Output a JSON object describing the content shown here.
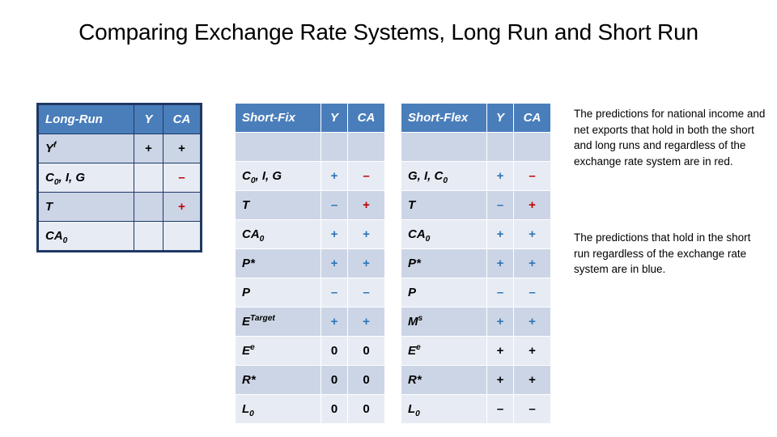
{
  "slide": {
    "title": "Comparing Exchange Rate Systems, Long Run and Short Run"
  },
  "colors": {
    "header_blue": "#4a7ebb",
    "band_dark": "#ccd5e6",
    "band_light": "#e7ecf4",
    "marker_blue": "#2e75b6",
    "marker_red": "#c00000",
    "marker_black": "#000000",
    "frame_navy": "#1f3864"
  },
  "tables": {
    "long_run": {
      "headers": [
        "Long-Run",
        "Y",
        "CA"
      ],
      "rows": [
        {
          "label": "Y",
          "label_sup": "f",
          "label_sub": "",
          "y": "+",
          "y_color": "black",
          "ca": "+",
          "ca_color": "black"
        },
        {
          "label": "C",
          "label_sub": "0",
          "label_tail": ", I, G",
          "y": "",
          "y_color": "black",
          "ca": "–",
          "ca_color": "red"
        },
        {
          "label": "T",
          "label_sub": "",
          "y": "",
          "y_color": "black",
          "ca": "+",
          "ca_color": "red"
        },
        {
          "label": "CA",
          "label_sub": "0",
          "y": "",
          "y_color": "black",
          "ca": "",
          "ca_color": "black"
        }
      ]
    },
    "short_fix": {
      "headers": [
        "Short-Fix",
        "Y",
        "CA"
      ],
      "rows": [
        {
          "label": "",
          "label_sub": "",
          "y": "",
          "y_color": "black",
          "ca": "",
          "ca_color": "black"
        },
        {
          "label": "C",
          "label_sub": "0",
          "label_tail": ", I, G",
          "y": "+",
          "y_color": "blue",
          "ca": "–",
          "ca_color": "red"
        },
        {
          "label": "T",
          "label_sub": "",
          "y": "–",
          "y_color": "blue",
          "ca": "+",
          "ca_color": "red"
        },
        {
          "label": "CA",
          "label_sub": "0",
          "y": "+",
          "y_color": "blue",
          "ca": "+",
          "ca_color": "blue"
        },
        {
          "label": "P*",
          "label_sub": "",
          "y": "+",
          "y_color": "blue",
          "ca": "+",
          "ca_color": "blue"
        },
        {
          "label": "P",
          "label_sub": "",
          "y": "–",
          "y_color": "blue",
          "ca": "–",
          "ca_color": "blue"
        },
        {
          "label": "E",
          "label_sup": "Target",
          "label_sub": "",
          "y": "+",
          "y_color": "blue",
          "ca": "+",
          "ca_color": "blue"
        },
        {
          "label": "E",
          "label_sup": "e",
          "label_sub": "",
          "y": "0",
          "y_color": "black",
          "ca": "0",
          "ca_color": "black"
        },
        {
          "label": "R*",
          "label_sub": "",
          "y": "0",
          "y_color": "black",
          "ca": "0",
          "ca_color": "black"
        },
        {
          "label": "L",
          "label_sub": "0",
          "y": "0",
          "y_color": "black",
          "ca": "0",
          "ca_color": "black"
        }
      ]
    },
    "short_flex": {
      "headers": [
        "Short-Flex",
        "Y",
        "CA"
      ],
      "rows": [
        {
          "label": "",
          "label_sub": "",
          "y": "",
          "y_color": "black",
          "ca": "",
          "ca_color": "black"
        },
        {
          "label": "G, I, C",
          "label_sub": "0",
          "y": "+",
          "y_color": "blue",
          "ca": "–",
          "ca_color": "red"
        },
        {
          "label": "T",
          "label_sub": "",
          "y": "–",
          "y_color": "blue",
          "ca": "+",
          "ca_color": "red"
        },
        {
          "label": "CA",
          "label_sub": "0",
          "y": "+",
          "y_color": "blue",
          "ca": "+",
          "ca_color": "blue"
        },
        {
          "label": "P*",
          "label_sub": "",
          "y": "+",
          "y_color": "blue",
          "ca": "+",
          "ca_color": "blue"
        },
        {
          "label": "P",
          "label_sub": "",
          "y": "–",
          "y_color": "blue",
          "ca": "–",
          "ca_color": "blue"
        },
        {
          "label": "M",
          "label_sup": "s",
          "label_sub": "",
          "y": "+",
          "y_color": "blue",
          "ca": "+",
          "ca_color": "blue"
        },
        {
          "label": "E",
          "label_sup": "e",
          "label_sub": "",
          "y": "+",
          "y_color": "black",
          "ca": "+",
          "ca_color": "black"
        },
        {
          "label": "R*",
          "label_sub": "",
          "y": "+",
          "y_color": "black",
          "ca": "+",
          "ca_color": "black"
        },
        {
          "label": "L",
          "label_sub": "0",
          "y": "–",
          "y_color": "black",
          "ca": "–",
          "ca_color": "black"
        }
      ]
    }
  },
  "notes": {
    "red_note": "The predictions for national income and net exports that hold in both the short and long runs and regardless of the exchange rate system are in red.",
    "blue_note": "The predictions that hold in the short run regardless of the exchange rate system are in blue."
  }
}
